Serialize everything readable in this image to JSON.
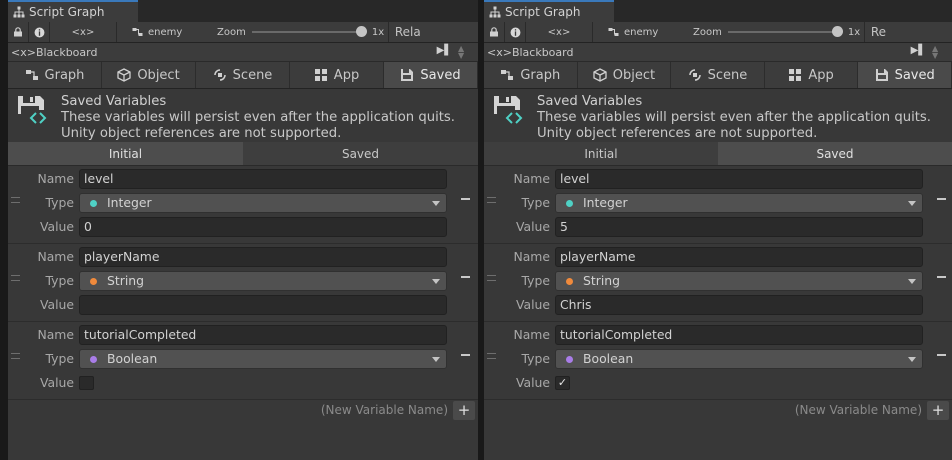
{
  "panels": [
    {
      "tab_title": "Script Graph",
      "toolbar": {
        "vars_label": "<x>",
        "graph_name": "enemy",
        "zoom_label": "Zoom",
        "zoom_value": "1x",
        "relayout": "Rela"
      },
      "blackboard_label": "<x>Blackboard",
      "scopes": [
        "Graph",
        "Object",
        "Scene",
        "App",
        "Saved"
      ],
      "active_scope": "Saved",
      "info": {
        "title": "Saved Variables",
        "line1": "These variables will persist even after the application quits.",
        "line2": "Unity object references are not supported."
      },
      "mode_tabs": [
        "Initial",
        "Saved"
      ],
      "active_mode": "Initial",
      "variables": [
        {
          "name": "level",
          "type": "Integer",
          "type_color": "#4fd1c5",
          "value": "0"
        },
        {
          "name": "playerName",
          "type": "String",
          "type_color": "#f08a3c",
          "value": ""
        },
        {
          "name": "tutorialCompleted",
          "type": "Boolean",
          "type_color": "#a97de8",
          "value": false
        }
      ],
      "labels": {
        "name": "Name",
        "type": "Type",
        "value": "Value"
      },
      "new_variable_placeholder": "(New Variable Name)",
      "add_label": "+"
    },
    {
      "tab_title": "Script Graph",
      "toolbar": {
        "vars_label": "<x>",
        "graph_name": "enemy",
        "zoom_label": "Zoom",
        "zoom_value": "1x",
        "relayout": "Re"
      },
      "blackboard_label": "<x>Blackboard",
      "scopes": [
        "Graph",
        "Object",
        "Scene",
        "App",
        "Saved"
      ],
      "active_scope": "Saved",
      "info": {
        "title": "Saved Variables",
        "line1": "These variables will persist even after the application quits.",
        "line2": "Unity object references are not supported."
      },
      "mode_tabs": [
        "Initial",
        "Saved"
      ],
      "active_mode": "Saved",
      "variables": [
        {
          "name": "level",
          "type": "Integer",
          "type_color": "#4fd1c5",
          "value": "5"
        },
        {
          "name": "playerName",
          "type": "String",
          "type_color": "#f08a3c",
          "value": "Chris"
        },
        {
          "name": "tutorialCompleted",
          "type": "Boolean",
          "type_color": "#a97de8",
          "value": true
        }
      ],
      "labels": {
        "name": "Name",
        "type": "Type",
        "value": "Value"
      },
      "new_variable_placeholder": "(New Variable Name)",
      "add_label": "+"
    }
  ]
}
